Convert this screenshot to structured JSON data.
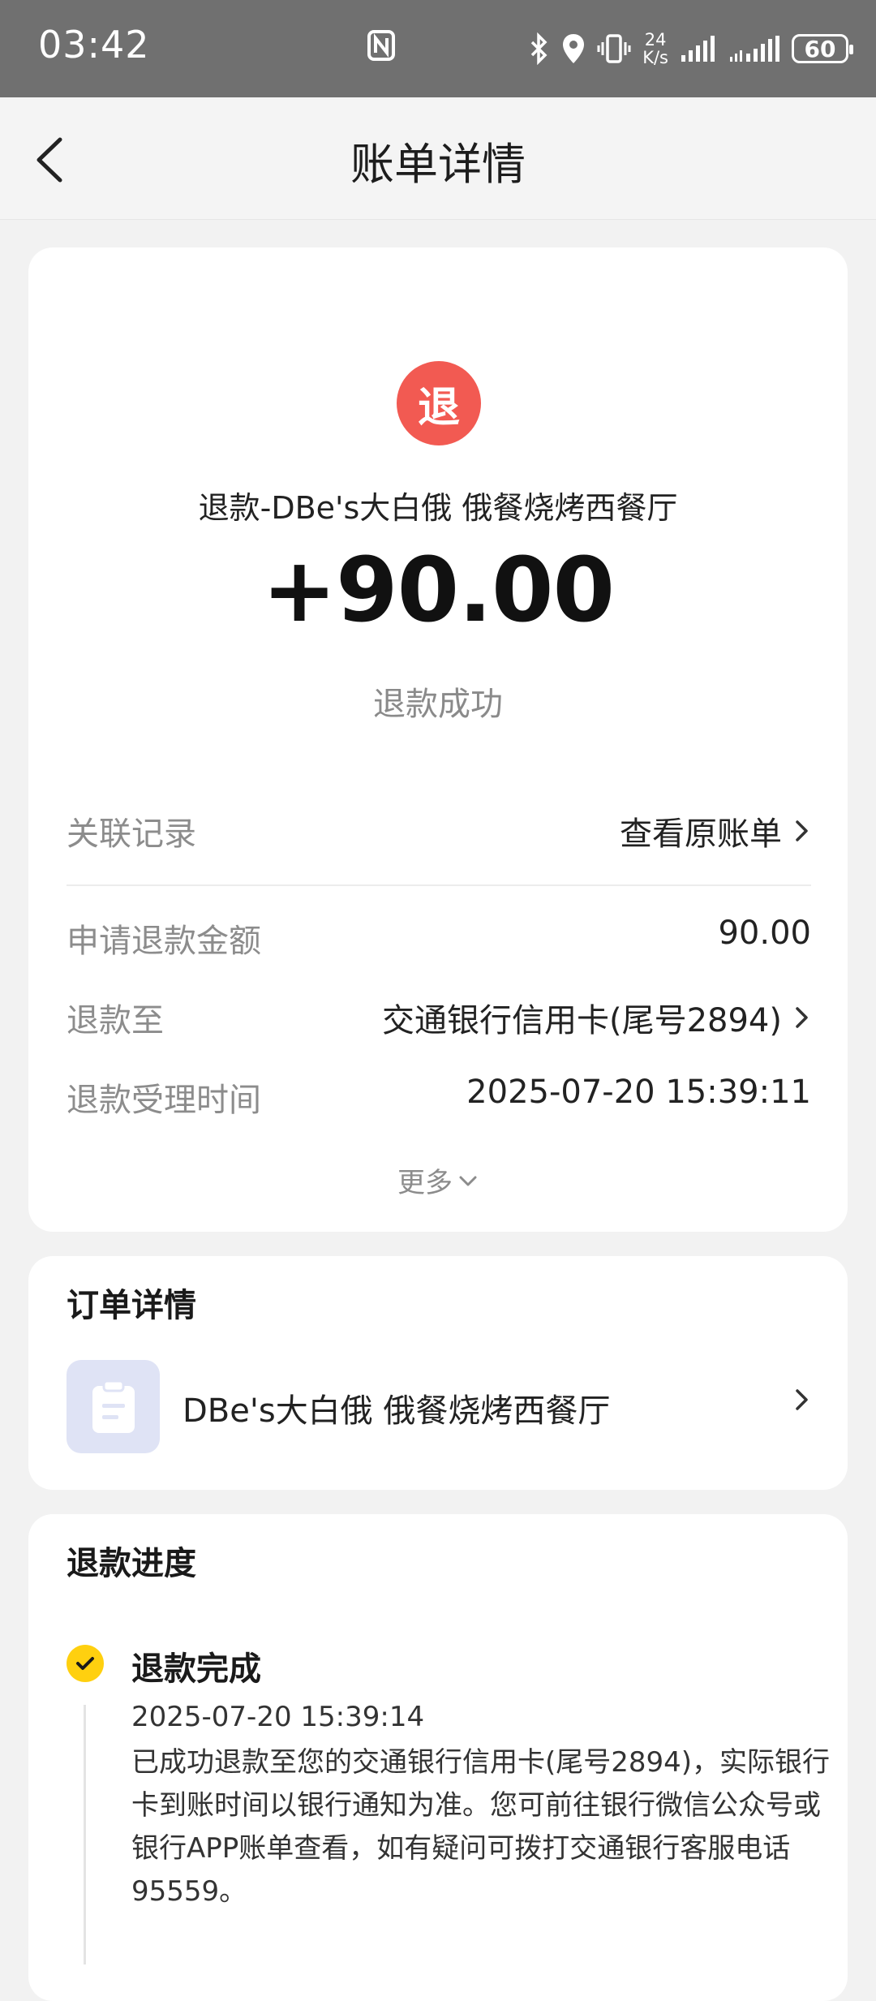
{
  "status_bar": {
    "time": "03:42",
    "net_speed_value": "24",
    "net_speed_unit": "K/s",
    "battery": "60"
  },
  "nav": {
    "title": "账单详情"
  },
  "summary": {
    "badge": "退",
    "merchant_title": "退款-DBe's大白俄 俄餐烧烤西餐厅",
    "amount": "+90.00",
    "status": "退款成功"
  },
  "details": {
    "related_label": "关联记录",
    "related_value": "查看原账单",
    "apply_amount_label": "申请退款金额",
    "apply_amount_value": "90.00",
    "refund_to_label": "退款至",
    "refund_to_value": "交通银行信用卡(尾号2894)",
    "accept_time_label": "退款受理时间",
    "accept_time_value": "2025-07-20 15:39:11",
    "more_label": "更多"
  },
  "order": {
    "section_title": "订单详情",
    "merchant_name": "DBe's大白俄 俄餐烧烤西餐厅"
  },
  "progress": {
    "section_title": "退款进度",
    "step_title": "退款完成",
    "step_time": "2025-07-20 15:39:14",
    "step_desc": "已成功退款至您的交通银行信用卡(尾号2894)，实际银行卡到账时间以银行通知为准。您可前往银行微信公众号或银行APP账单查看，如有疑问可拨打交通银行客服电话95559。"
  },
  "colors": {
    "badge_red": "#f25a52",
    "step_yellow": "#ffd00f",
    "status_bar_gray": "#707070"
  }
}
